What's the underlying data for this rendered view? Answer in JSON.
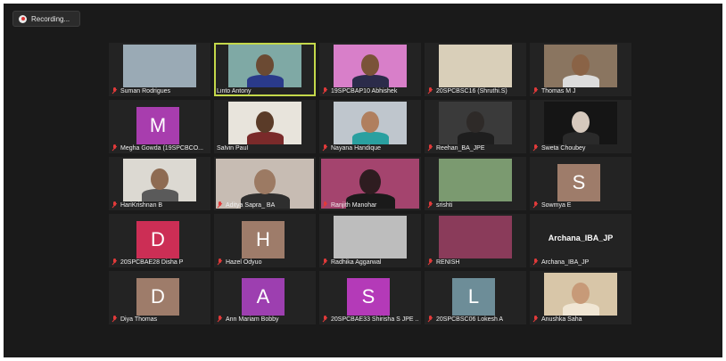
{
  "recording": {
    "label": "Recording..."
  },
  "participants": [
    {
      "name": "Suman Rodrigues",
      "muted": true,
      "type": "image",
      "bg": "#9aaab5"
    },
    {
      "name": "Linto Antony",
      "muted": false,
      "type": "video",
      "bg": "#7fa9a5",
      "skin": "#6b4a33",
      "shirt": "#2a3a8a",
      "active": true
    },
    {
      "name": "19SPCBAP10 Abhishek",
      "muted": true,
      "type": "video",
      "bg": "#d87fc9",
      "skin": "#7a5338",
      "shirt": "#2b2b4a"
    },
    {
      "name": "20SPCBSC16 (Shruthi.S)",
      "muted": true,
      "type": "image",
      "bg": "#d9cfb9"
    },
    {
      "name": "Thomas M J",
      "muted": true,
      "type": "video",
      "bg": "#8a7560",
      "skin": "#8a6346",
      "shirt": "#dcdcdc"
    },
    {
      "name": "Megha Gowda (19SPCBCO...",
      "muted": true,
      "type": "initial",
      "initial": "M",
      "bg": "#a83dae"
    },
    {
      "name": "Salvin Paul",
      "muted": false,
      "type": "video",
      "bg": "#e8e4dc",
      "skin": "#5a3b28",
      "shirt": "#7a2a2a"
    },
    {
      "name": "Nayana Handique",
      "muted": true,
      "type": "video",
      "bg": "#bfc6cd",
      "skin": "#b07f5e",
      "shirt": "#2aa0a0"
    },
    {
      "name": "Reehan_BA_JPE",
      "muted": true,
      "type": "video",
      "bg": "#3a3a3a",
      "skin": "#2e2a28",
      "shirt": "#1e1e1e"
    },
    {
      "name": "Sweta Choubey",
      "muted": true,
      "type": "video",
      "bg": "#151515",
      "skin": "#d6c9bd",
      "shirt": "#2a2a2a"
    },
    {
      "name": "HariKrishnan B",
      "muted": true,
      "type": "video",
      "bg": "#dcd9d2",
      "skin": "#8e6b52",
      "shirt": "#5a5a5a"
    },
    {
      "name": "Aditya Sapra_ BA",
      "muted": true,
      "type": "video",
      "bg": "#c7bcb3",
      "skin": "#9c7a63",
      "shirt": "#2e2e2e",
      "full": true
    },
    {
      "name": "Ranjith Manohar",
      "muted": true,
      "type": "video",
      "bg": "#a4446e",
      "skin": "#2e1c20",
      "shirt": "#1a1a1a",
      "full": true
    },
    {
      "name": "srishti",
      "muted": true,
      "type": "image",
      "bg": "#7b9a70"
    },
    {
      "name": "Sowmya E",
      "muted": true,
      "type": "initial",
      "initial": "S",
      "bg": "#9e7c6a"
    },
    {
      "name": "20SPCBAE28 Disha P",
      "muted": true,
      "type": "initial",
      "initial": "D",
      "bg": "#cc2e55"
    },
    {
      "name": "Hazel Odyuo",
      "muted": true,
      "type": "initial",
      "initial": "H",
      "bg": "#9e7c6a"
    },
    {
      "name": "Radhika Aggarwal",
      "muted": true,
      "type": "image",
      "bg": "#bdbdbd"
    },
    {
      "name": "RENISH",
      "muted": true,
      "type": "image",
      "bg": "#8a3b5a"
    },
    {
      "name": "Archana_IBA_JP",
      "muted": true,
      "type": "text",
      "bigname": "Archana_IBA_JP"
    },
    {
      "name": "Diya Thomas",
      "muted": true,
      "type": "initial",
      "initial": "D",
      "bg": "#9e7c6a"
    },
    {
      "name": "Ann Mariam Bobby",
      "muted": true,
      "type": "initial",
      "initial": "A",
      "bg": "#9d3fb0"
    },
    {
      "name": "20SPCBAE33 Shirisha S JPE ...",
      "muted": true,
      "type": "initial",
      "initial": "S",
      "bg": "#b43ab8"
    },
    {
      "name": "20SPCBSC06 Lokesh A",
      "muted": true,
      "type": "initial",
      "initial": "L",
      "bg": "#6d8d98"
    },
    {
      "name": "Anushka Saha",
      "muted": true,
      "type": "video",
      "bg": "#d8c6a8",
      "skin": "#c79a78",
      "shirt": "#f0e6d4"
    }
  ]
}
